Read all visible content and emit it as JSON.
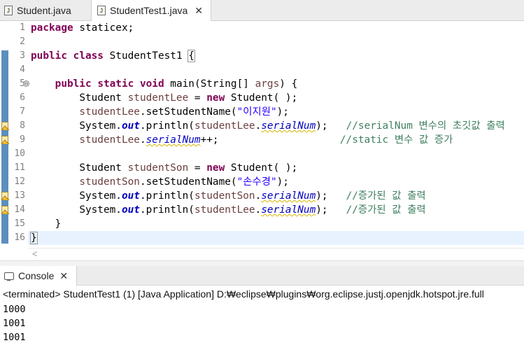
{
  "editor_tabs": [
    {
      "label": "Student.java",
      "active": false
    },
    {
      "label": "StudentTest1.java",
      "active": true,
      "close": "✕"
    }
  ],
  "line_numbers": [
    "1",
    "2",
    "3",
    "4",
    "5",
    "6",
    "7",
    "8",
    "9",
    "10",
    "11",
    "12",
    "13",
    "14",
    "15",
    "16"
  ],
  "code": {
    "l1": [
      "package",
      " staticex;"
    ],
    "l3": [
      "public",
      " ",
      "class",
      " StudentTest1 ",
      "{"
    ],
    "l5": [
      "public",
      " ",
      "static",
      " ",
      "void",
      " main(String[] ",
      "args",
      ") {"
    ],
    "l6": [
      "Student ",
      "studentLee",
      " = ",
      "new",
      " Student( );"
    ],
    "l7": [
      "studentLee",
      ".setStudentName(",
      "\"이지원\"",
      ");"
    ],
    "l8": [
      "System.",
      "out",
      ".println(",
      "studentLee",
      ".",
      "serialNum",
      ");   ",
      "//serialNum 변수의 초깃값 출력"
    ],
    "l9": [
      "studentLee",
      ".",
      "serialNum",
      "++;",
      "//static 변수 값 증가"
    ],
    "l11": [
      "Student ",
      "studentSon",
      " = ",
      "new",
      " Student( );"
    ],
    "l12": [
      "studentSon",
      ".setStudentName(",
      "\"손수경\"",
      ");"
    ],
    "l13": [
      "System.",
      "out",
      ".println(",
      "studentSon",
      ".",
      "serialNum",
      ");   ",
      "//증가된 값 출력"
    ],
    "l14": [
      "System.",
      "out",
      ".println(",
      "studentLee",
      ".",
      "serialNum",
      ");   ",
      "//증가된 값 출력"
    ],
    "l15": [
      "}"
    ],
    "l16": [
      "}"
    ]
  },
  "fold_glyph": "⊖",
  "hscroll_arrow": "<",
  "console": {
    "tab_label": "Console",
    "close": "✕",
    "status": "<terminated> StudentTest1 (1) [Java Application] D:₩eclipse₩plugins₩org.eclipse.justj.openjdk.hotspot.jre.full",
    "output": [
      "1000",
      "1001",
      "1001"
    ]
  },
  "colors": {
    "keyword": "#7f0055",
    "local_variable": "#6a3e3e",
    "string": "#2a00ff",
    "field": "#0000c0",
    "comment": "#3f7f5f",
    "current_line": "#e8f2fe"
  },
  "icons": [
    "java-file-icon",
    "warning-icon",
    "console-icon",
    "close-icon",
    "fold-icon"
  ]
}
